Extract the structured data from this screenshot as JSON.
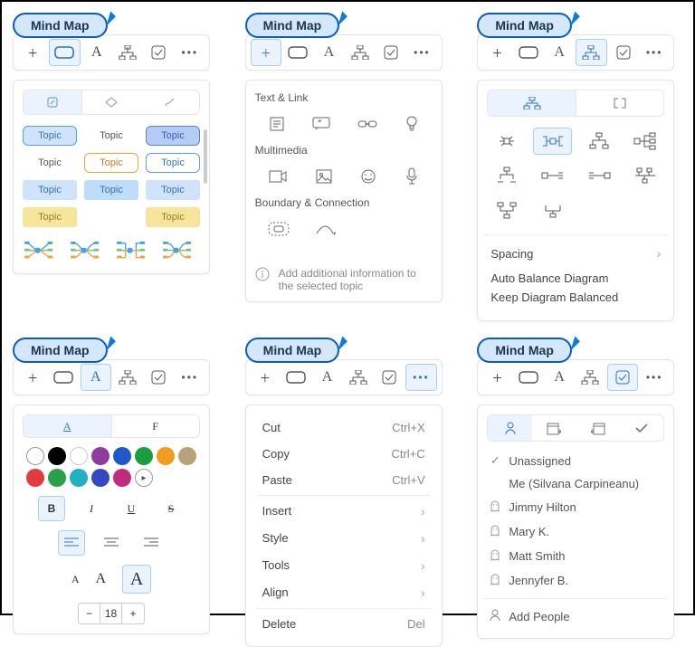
{
  "pill_label": "Mind Map",
  "panel1": {
    "tabs": [
      "✎",
      "◇",
      "✍"
    ],
    "chips": [
      {
        "label": "Topic",
        "bg": "#cfe3fb",
        "border": "#579fe8",
        "text": "#2d73c4"
      },
      {
        "label": "Topic",
        "bg": "#ffffff",
        "border": "transparent",
        "text": "#555"
      },
      {
        "label": "Topic",
        "bg": "#b3cdf6",
        "border": "#5e7fd1",
        "text": "#3c5ea8"
      },
      {
        "label": "Topic",
        "bg": "#ffffff",
        "border": "transparent",
        "text": "#555"
      },
      {
        "label": "Topic",
        "bg": "#ffffff",
        "border": "#f0a33a",
        "text": "#c87a1d"
      },
      {
        "label": "Topic",
        "bg": "#ffffff",
        "border": "#579fe8",
        "text": "#2d73c4"
      },
      {
        "label": "Topic",
        "bg": "#cfe3fb",
        "border": "transparent",
        "text": "#2d73c4",
        "radius": "3px"
      },
      {
        "label": "Topic",
        "bg": "#bfdcfa",
        "border": "transparent",
        "text": "#2d73c4",
        "radius": "3px"
      },
      {
        "label": "Topic",
        "bg": "#cfe3fb",
        "border": "transparent",
        "text": "#2d73c4",
        "radius": "3px"
      },
      {
        "label": "Topic",
        "bg": "#f6e59a",
        "border": "transparent",
        "text": "#9a7e1b",
        "radius": "3px"
      },
      {
        "label": "",
        "bg": "transparent",
        "border": "transparent",
        "text": "transparent"
      },
      {
        "label": "Topic",
        "bg": "#f6e59a",
        "border": "transparent",
        "text": "#9a7e1b",
        "radius": "3px"
      }
    ]
  },
  "panel2": {
    "sections": [
      {
        "label": "Text & Link",
        "icons": [
          "note",
          "quote",
          "link",
          "bulb"
        ]
      },
      {
        "label": "Multimedia",
        "icons": [
          "video",
          "image",
          "smile",
          "mic"
        ]
      },
      {
        "label": "Boundary & Connection",
        "icons": [
          "boundary",
          "rel"
        ]
      }
    ],
    "hint": "Add additional information to the selected topic"
  },
  "panel3": {
    "menu": [
      {
        "label": "Spacing",
        "go": true
      },
      {
        "label": "Auto Balance Diagram"
      },
      {
        "label": "Keep Diagram Balanced"
      }
    ]
  },
  "panel4": {
    "tabs": [
      "A",
      "F"
    ],
    "colors1": [
      "",
      "#000000",
      "#ffffff",
      "#8e3d9e",
      "#1f58c7",
      "#1a9e3f",
      "#f19c1f"
    ],
    "colors2": [
      "#b9a27a",
      "#e23b3b",
      "#2aa04b",
      "#21b0c0",
      "#3647c2",
      "#c22b7d",
      ""
    ],
    "bold": "B",
    "italic": "I",
    "underline": "U",
    "strike": "S",
    "size_val": "18"
  },
  "panel5": {
    "items": [
      {
        "label": "Cut",
        "accel": "Ctrl+X"
      },
      {
        "label": "Copy",
        "accel": "Ctrl+C"
      },
      {
        "label": "Paste",
        "accel": "Ctrl+V"
      },
      {
        "sep": true
      },
      {
        "label": "Insert",
        "go": true
      },
      {
        "label": "Style",
        "go": true
      },
      {
        "label": "Tools",
        "go": true
      },
      {
        "label": "Align",
        "go": true
      },
      {
        "sep": true
      },
      {
        "label": "Delete",
        "accel": "Del"
      }
    ]
  },
  "panel6": {
    "people": [
      {
        "icon": "check",
        "label": "Unassigned"
      },
      {
        "icon": "",
        "label": "Me (Silvana Carpineanu)"
      },
      {
        "icon": "ghost",
        "label": "Jimmy Hilton"
      },
      {
        "icon": "ghost",
        "label": "Mary K."
      },
      {
        "icon": "ghost",
        "label": "Matt Smith"
      },
      {
        "icon": "ghost",
        "label": "Jennyfer B."
      }
    ],
    "add": "Add People"
  }
}
